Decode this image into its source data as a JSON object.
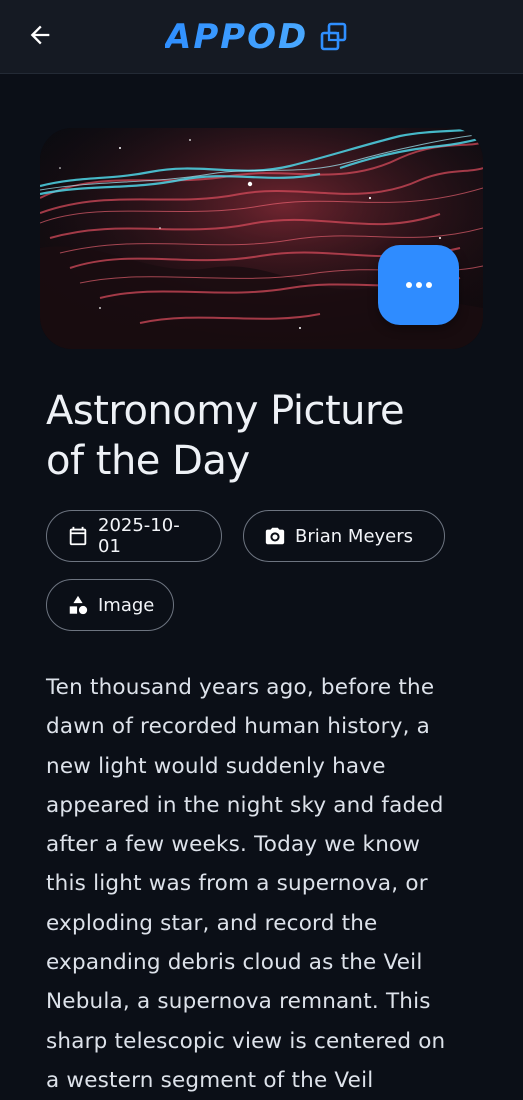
{
  "header": {
    "back_label": "Back",
    "brand": "APPOD"
  },
  "hero": {
    "more_label": "•••"
  },
  "title_lines": [
    "Astronomy Picture",
    "of the Day"
  ],
  "chips": {
    "date": "2025-10-01",
    "author": "Brian Meyers",
    "media_type": "Image"
  },
  "description_lines": [
    "Ten thousand years ago, before the",
    "dawn of recorded human history, a",
    "new light would suddenly have",
    "appeared in the night sky and faded",
    "after a few weeks.  Today we know",
    "this light was from a supernova, or",
    "exploding star, and record the",
    "expanding debris cloud as the Veil",
    "Nebula, a supernova remnant.  This",
    "sharp telescopic view is centered on",
    "a western segment of the Veil"
  ],
  "colors": {
    "accent": "#2f8cff",
    "background": "#0b0f17",
    "topbar": "#151a23",
    "chip_border": "#6d7480"
  },
  "icons": {
    "back": "arrow-left-icon",
    "brand": "overlapping-squares-icon",
    "more": "more-horizontal-icon",
    "date": "calendar-icon",
    "author": "camera-icon",
    "type": "shapes-icon"
  }
}
